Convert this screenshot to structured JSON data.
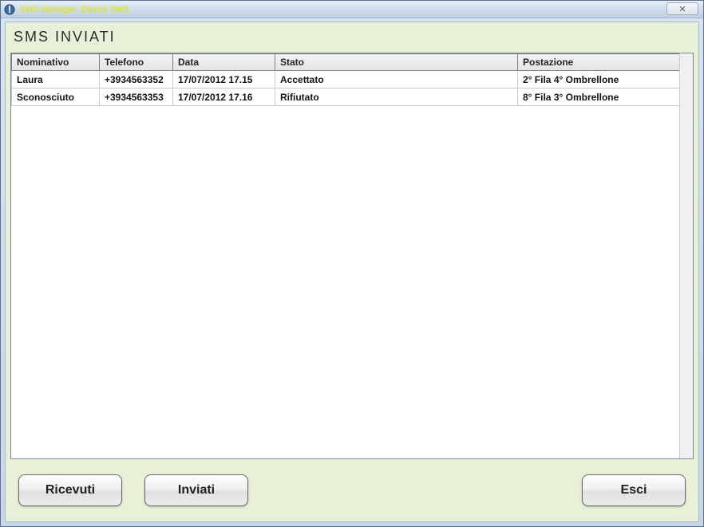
{
  "window": {
    "title": "SMS Manager: Elenco SMS",
    "close_glyph": "✕"
  },
  "section": {
    "title": "SMS INVIATI"
  },
  "grid": {
    "headers": {
      "nominativo": "Nominativo",
      "telefono": "Telefono",
      "data": "Data",
      "stato": "Stato",
      "postazione": "Postazione"
    },
    "rows": [
      {
        "nominativo": "Laura",
        "telefono": "+3934563352",
        "data": "17/07/2012 17.15",
        "stato": "Accettato",
        "postazione": "2° Fila 4° Ombrellone"
      },
      {
        "nominativo": "Sconosciuto",
        "telefono": "+3934563353",
        "data": "17/07/2012 17.16",
        "stato": "Rifiutato",
        "postazione": "8° Fila 3° Ombrellone"
      }
    ]
  },
  "buttons": {
    "ricevuti": "Ricevuti",
    "inviati": "Inviati",
    "esci": "Esci"
  }
}
